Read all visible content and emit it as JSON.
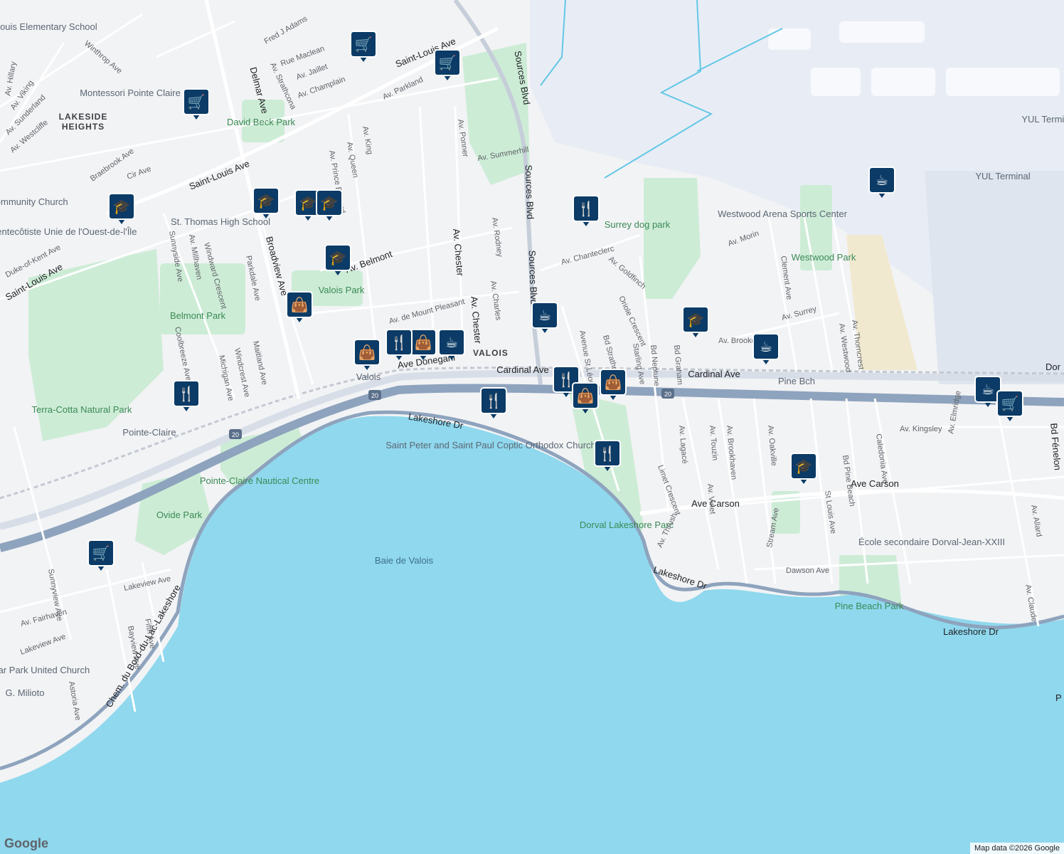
{
  "map": {
    "water_label": "Baie de Valois",
    "area_labels": [
      "LAKESIDE HEIGHTS",
      "VALOIS"
    ],
    "park_labels": [
      "David Beck Park",
      "Valois Park",
      "Belmont Park",
      "Terra-Cotta Natural Park",
      "Pointe-Claire Nautical Centre",
      "Ovide Park",
      "Surrey dog park",
      "Westwood Park",
      "Dorval Lakeshore Parc",
      "Pine Beach Park"
    ],
    "poi_labels": [
      "St. Louis Elementary School",
      "Montessori Pointe Claire",
      "St. Thomas High School",
      "Community Church",
      "Église Pentecôtiste Unie de l'Ouest-de-l'Île",
      "Saint Peter and Saint Paul Coptic Orthodox Church",
      "Westwood Arena Sports Center",
      "École secondaire Dorval-Jean-XXIII",
      "Cedar Park United Church",
      "G. Milioto",
      "YUL Terminal",
      "Valois",
      "Pointe-Claire",
      "Pine Bch"
    ],
    "major_roads": [
      "Cardinal Ave",
      "Ave Donegani",
      "Lakeshore Dr",
      "Sources Blvd",
      "Saint-Louis Ave",
      "Ave Carson",
      "Delmar Ave",
      "Broadview Ave",
      "Av. Belmont",
      "Av. Chester",
      "Bd Fénelon",
      "Chem. du Bord-du-Lac-Lakeshore"
    ],
    "minor_roads": [
      "Av. Summerhill",
      "Av. Chanteclerc",
      "Av. Goldfinch",
      "Oriole Crescent",
      "Bd Strathmore",
      "Avenue St Léon",
      "Starling Ave",
      "Bd Neptune",
      "Bd Graham",
      "Av. Brookdale",
      "Av. Morin",
      "Clement Ave",
      "St Louis Ave",
      "Bd Pine Beach",
      "Av. Westwood",
      "Av. Thorncrest",
      "Av. Surrey",
      "Av. Kingsley",
      "Av. Elmridge",
      "Caledonia Ave",
      "Av. Lagacé",
      "Av. Touzin",
      "Av. Brookhaven",
      "Av. Oakville",
      "Av. Vinet",
      "Limet Crescent",
      "Av. Thrush",
      "Stream Ave",
      "Dawson Ave",
      "Av. Allard",
      "Av. Claude",
      "Av. Rodney",
      "Av. Charles",
      "Av. Ponner",
      "Av. Parkland",
      "Av. Champlain",
      "Av. Jaillet",
      "Rue Maclean",
      "Fred J Adams",
      "Av. Strathcona",
      "Av. King",
      "Av. Queen",
      "Av. Prince Edward",
      "Av. de Mount Pleasant",
      "Sunnyside Ave",
      "Av. Millhaven",
      "Windward Crescent",
      "Parkdale Ave",
      "Maitland Ave",
      "Windcrest Ave",
      "Michigan Ave",
      "Coolbreeze Ave",
      "Duke-of-Kent Ave",
      "Braebrook Ave",
      "Cir Ave",
      "Av. Westcliffe",
      "Av. Sunderland",
      "Av. Viking",
      "Av. Hillary",
      "Winthrop Ave",
      "Lakeview Ave",
      "Av. Fairhaven",
      "Sunnyview Ave",
      "Bayview Ave",
      "Fifth Ave",
      "Astoria Ave"
    ],
    "highway_shield": "20",
    "airport_labels": [
      "YUL Terminal",
      "YUL Terminal"
    ],
    "edge_labels": [
      "Dor",
      "P"
    ]
  },
  "markers": [
    {
      "icon": "shopping-cart-icon",
      "glyph": "🛒"
    },
    {
      "icon": "shopping-cart-icon",
      "glyph": "🛒"
    },
    {
      "icon": "shopping-cart-icon",
      "glyph": "🛒"
    },
    {
      "icon": "school-icon",
      "glyph": "🎓"
    },
    {
      "icon": "school-icon",
      "glyph": "🎓"
    },
    {
      "icon": "school-icon",
      "glyph": "🎓"
    },
    {
      "icon": "school-icon",
      "glyph": "🎓"
    },
    {
      "icon": "school-icon",
      "glyph": "🎓"
    },
    {
      "icon": "shopping-bag-icon",
      "glyph": "👜"
    },
    {
      "icon": "shopping-bag-icon",
      "glyph": "👜"
    },
    {
      "icon": "shopping-bag-icon",
      "glyph": "👜"
    },
    {
      "icon": "restaurant-icon",
      "glyph": "🍴"
    },
    {
      "icon": "restaurant-icon",
      "glyph": "🍴"
    },
    {
      "icon": "restaurant-icon",
      "glyph": "🍴"
    },
    {
      "icon": "restaurant-icon",
      "glyph": "🍴"
    },
    {
      "icon": "restaurant-icon",
      "glyph": "🍴"
    },
    {
      "icon": "coffee-icon",
      "glyph": "☕"
    },
    {
      "icon": "coffee-icon",
      "glyph": "☕"
    },
    {
      "icon": "coffee-icon",
      "glyph": "☕"
    },
    {
      "icon": "coffee-icon",
      "glyph": "☕"
    },
    {
      "icon": "coffee-icon",
      "glyph": "☕"
    },
    {
      "icon": "shopping-bag-icon",
      "glyph": "👜"
    },
    {
      "icon": "shopping-bag-icon",
      "glyph": "👜"
    },
    {
      "icon": "shopping-cart-icon",
      "glyph": "🛒"
    },
    {
      "icon": "shopping-cart-icon",
      "glyph": "🛒"
    },
    {
      "icon": "school-icon",
      "glyph": "🎓"
    },
    {
      "icon": "school-icon",
      "glyph": "🎓"
    },
    {
      "icon": "restaurant-icon",
      "glyph": "🍴"
    }
  ],
  "attribution": "Map data ©2026 Google",
  "logo": "Google",
  "colors": {
    "water": "#8fd8ee",
    "park": "#cdecd6",
    "land": "#f2f3f5",
    "highway": "#8ea3bd",
    "marker": "#0b3b66",
    "airport": "#e8edf5"
  }
}
